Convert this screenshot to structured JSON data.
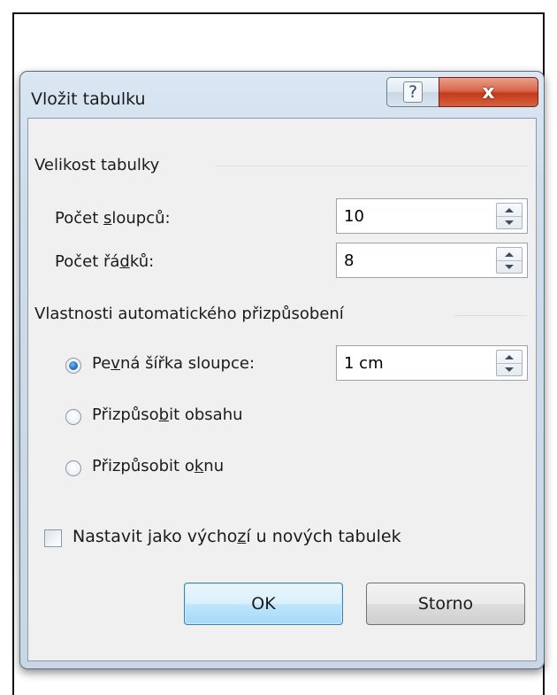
{
  "dialog": {
    "title": "Vložit tabulku",
    "help_glyph": "?",
    "close_glyph": "x"
  },
  "table_size": {
    "group_label": "Velikost tabulky",
    "columns_label_before": "Počet ",
    "columns_label_accel": "s",
    "columns_label_after": "loupců:",
    "columns_value": "10",
    "rows_label_before": "Počet řá",
    "rows_label_accel": "d",
    "rows_label_after": "ků:",
    "rows_value": "8"
  },
  "autofit": {
    "group_label": "Vlastnosti automatického přizpůsobení",
    "fixed_before": "Pe",
    "fixed_accel": "v",
    "fixed_after": "ná šířka sloupce:",
    "fixed_value": "1 cm",
    "fixed_checked": true,
    "contents_before": "Přizpůso",
    "contents_accel": "b",
    "contents_after": "it obsahu",
    "window_before": "Přizpůsobit o",
    "window_accel": "k",
    "window_after": "nu"
  },
  "default_checkbox": {
    "label_before": "Nastavit jako výcho",
    "label_accel": "z",
    "label_after": "í u nových tabulek",
    "checked": false
  },
  "buttons": {
    "ok_label": "OK",
    "cancel_label": "Storno"
  },
  "icons": [
    "help-icon",
    "close-icon",
    "spin-up-icon",
    "spin-down-icon"
  ]
}
